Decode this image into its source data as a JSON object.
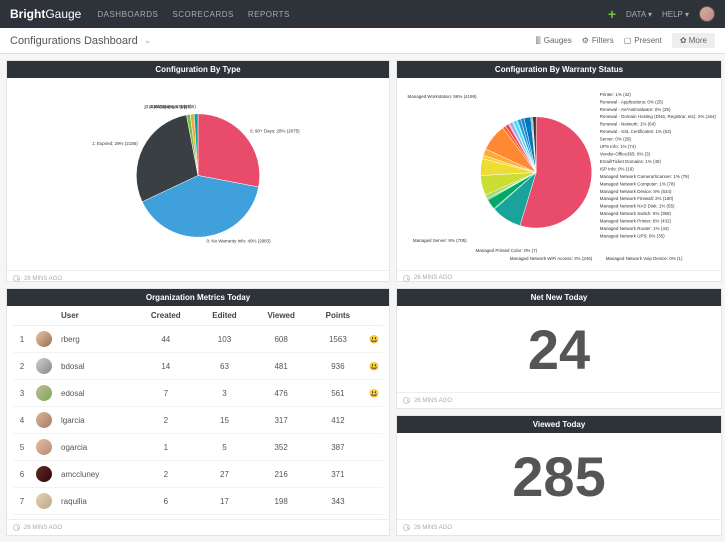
{
  "brand_a": "Bright",
  "brand_b": "Gauge",
  "nav": [
    "DASHBOARDS",
    "SCORECARDS",
    "REPORTS"
  ],
  "top_right": {
    "data": "DATA",
    "help": "HELP"
  },
  "dashboard_title": "Configurations Dashboard",
  "sub_links": {
    "gauges": "Gauges",
    "filters": "Filters",
    "present": "Present",
    "more": "✿ More"
  },
  "timestamp": "26 MINS AGO",
  "panels": {
    "type": {
      "title": "Configuration By Type"
    },
    "warranty": {
      "title": "Configuration By Warranty Status"
    },
    "metrics": {
      "title": "Organization Metrics Today",
      "cols": [
        "",
        "",
        "User",
        "Created",
        "Edited",
        "Viewed",
        "Points",
        ""
      ]
    },
    "netnew": {
      "title": "Net New Today",
      "value": "24"
    },
    "viewed": {
      "title": "Viewed Today",
      "value": "285"
    }
  },
  "metrics_rows": [
    {
      "rank": "1",
      "user": "rberg",
      "created": "44",
      "edited": "103",
      "viewed": "608",
      "points": "1563",
      "emoji": "😃",
      "avatar_bg": "linear-gradient(135deg,#e8c7a8,#9a6b4a)"
    },
    {
      "rank": "2",
      "user": "bdosal",
      "created": "14",
      "edited": "63",
      "viewed": "481",
      "points": "936",
      "emoji": "😃",
      "avatar_bg": "linear-gradient(135deg,#d0d0d0,#888)"
    },
    {
      "rank": "3",
      "user": "edosal",
      "created": "7",
      "edited": "3",
      "viewed": "476",
      "points": "561",
      "emoji": "😃",
      "avatar_bg": "linear-gradient(135deg,#c8b8a0,#7a5)"
    },
    {
      "rank": "4",
      "user": "lgarcia",
      "created": "2",
      "edited": "15",
      "viewed": "317",
      "points": "412",
      "emoji": "",
      "avatar_bg": "linear-gradient(135deg,#d8b898,#a76)"
    },
    {
      "rank": "5",
      "user": "ogarcia",
      "created": "1",
      "edited": "5",
      "viewed": "352",
      "points": "387",
      "emoji": "",
      "avatar_bg": "linear-gradient(135deg,#e0c0a0,#b87)"
    },
    {
      "rank": "6",
      "user": "amccluney",
      "created": "2",
      "edited": "27",
      "viewed": "216",
      "points": "371",
      "emoji": "",
      "avatar_bg": "linear-gradient(135deg,#603020,#301)"
    },
    {
      "rank": "7",
      "user": "raquilia",
      "created": "6",
      "edited": "17",
      "viewed": "198",
      "points": "343",
      "emoji": "",
      "avatar_bg": "linear-gradient(135deg,#e8d0b8,#ba8)"
    }
  ],
  "chart_data": [
    {
      "type": "pie",
      "title": "Configuration By Type",
      "series": [
        {
          "name": "5: 90+ Days",
          "pct": 28,
          "count": 2075,
          "label": "5: 90+ Days: 28% (2075)",
          "color": "#e94b6a"
        },
        {
          "name": "0: No Warranty Info",
          "pct": 40,
          "count": 2983,
          "label": "0: No Warranty Info: 40% (2983)",
          "color": "#3fa0dc"
        },
        {
          "name": "1: Expired",
          "pct": 29,
          "count": 2185,
          "label": "1: Expired: 29% (2185)",
          "color": "#3a3f44"
        },
        {
          "name": "2: 0-30 Days",
          "pct": 1,
          "count": 91,
          "label": "2: 0-30 Days: 1% (91)",
          "color": "#7bc043"
        },
        {
          "name": "3: 31-60 Days",
          "pct": 1,
          "count": 89,
          "label": "3: 31-60 Days: 1% (89)",
          "color": "#f2a93b"
        },
        {
          "name": "4: 61-90 Days",
          "pct": 1,
          "count": 85,
          "label": "4: 61-90 Days: 1% (85)",
          "color": "#00a6a6"
        }
      ]
    },
    {
      "type": "pie",
      "title": "Configuration By Warranty Status",
      "series": [
        {
          "name": "Managed Workstation",
          "pct": 56,
          "count": 4199,
          "label": "Managed Workstation: 56% (4199)",
          "color": "#e94b6a"
        },
        {
          "name": "Managed Server",
          "pct": 9,
          "count": 705,
          "label": "Managed Server: 9% (705)",
          "color": "#1aa39a"
        },
        {
          "name": "Managed Printed Color",
          "pct": 0,
          "count": 7,
          "label": "Managed Printed Color: 0% (7)",
          "color": "#2c8"
        },
        {
          "name": "Managed Network WiFi Access",
          "pct": 3,
          "count": 246,
          "label": "Managed Network WiFi Access: 3% (246)",
          "color": "#0a6"
        },
        {
          "name": "Managed Network Voip Device",
          "pct": 0,
          "count": 1,
          "label": "Managed Network Voip Device: 0% (1)",
          "color": "#084"
        },
        {
          "name": "Managed Network UPS",
          "pct": 0,
          "count": 35,
          "label": "Managed Network UPS: 0% (35)",
          "color": "#6c4"
        },
        {
          "name": "Managed Network Router",
          "pct": 1,
          "count": 44,
          "label": "Managed Network Router: 1% (44)",
          "color": "#9d5"
        },
        {
          "name": "Managed Network Printer",
          "pct": 6,
          "count": 432,
          "label": "Managed Network Printer: 6% (432)",
          "color": "#cd3"
        },
        {
          "name": "Managed Network Switch",
          "pct": 5,
          "count": 358,
          "label": "Managed Network Switch: 5% (358)",
          "color": "#ed3"
        },
        {
          "name": "Managed Network NAS Disk",
          "pct": 1,
          "count": 55,
          "label": "Managed Network NAS Disk: 1% (55)",
          "color": "#fc3"
        },
        {
          "name": "Managed Network Firewall",
          "pct": 2,
          "count": 180,
          "label": "Managed Network Firewall: 2% (180)",
          "color": "#fa3"
        },
        {
          "name": "Managed Network Device",
          "pct": 8,
          "count": 634,
          "label": "Managed Network Device: 8% (634)",
          "color": "#f83"
        },
        {
          "name": "Managed Network Computer",
          "pct": 1,
          "count": 78,
          "label": "Managed Network Computer: 1% (78)",
          "color": "#f63"
        },
        {
          "name": "Managed Network Camera/Scanner",
          "pct": 1,
          "count": 79,
          "label": "Managed Network Camera/Scanner: 1% (79)",
          "color": "#e44"
        },
        {
          "name": "ISP Info",
          "pct": 0,
          "count": 16,
          "label": "ISP Info: 0% (16)",
          "color": "#c8e"
        },
        {
          "name": "Email/Ticket Domains",
          "pct": 1,
          "count": 40,
          "label": "Email/Ticket Domains: 1% (40)",
          "color": "#9ae"
        },
        {
          "name": "Vendor-Office365",
          "pct": 0,
          "count": 3,
          "label": "Vendor-Office365: 0% (3)",
          "color": "#6ce"
        },
        {
          "name": "UPS Info",
          "pct": 1,
          "count": 74,
          "label": "UPS Info: 1% (74)",
          "color": "#4de"
        },
        {
          "name": "Server",
          "pct": 0,
          "count": 29,
          "label": "Server: 0% (29)",
          "color": "#3be"
        },
        {
          "name": "Renewal - SSL Certificates",
          "pct": 1,
          "count": 53,
          "label": "Renewal - SSL Certificates: 1% (53)",
          "color": "#29d"
        },
        {
          "name": "Renewal - Network",
          "pct": 1,
          "count": 64,
          "label": "Renewal - Network: 1% (64)",
          "color": "#18c"
        },
        {
          "name": "Renewal - Domain Hosting (DNS, Registrar, etc)",
          "pct": 2,
          "count": 164,
          "label": "Renewal - Domain Hosting (DNS, Registrar, etc): 2% (164)",
          "color": "#07b"
        },
        {
          "name": "Renewal - AV/Antimalware",
          "pct": 0,
          "count": 25,
          "label": "Renewal - AV/Antimalware: 0% (25)",
          "color": "#069"
        },
        {
          "name": "Renewal - Applications",
          "pct": 0,
          "count": 25,
          "label": "Renewal - Applications: 0% (25)",
          "color": "#356"
        },
        {
          "name": "Printer",
          "pct": 1,
          "count": 42,
          "label": "Printer: 1% (42)",
          "color": "#333"
        }
      ]
    }
  ]
}
